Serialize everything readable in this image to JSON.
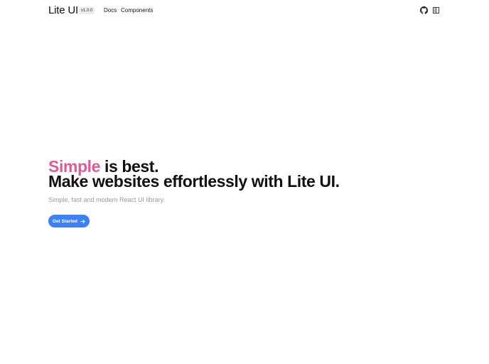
{
  "header": {
    "brand": "Lite UI",
    "version": "v1.0.0",
    "nav": [
      {
        "label": "Docs"
      },
      {
        "label": "Components"
      }
    ],
    "icons": [
      "github-icon",
      "theme-toggle-icon"
    ]
  },
  "hero": {
    "accent_word": "Simple",
    "line1_rest": " is best.",
    "line2": "Make websites effortlessly with Lite UI.",
    "subtitle": "Simple, fast and modern React UI library.",
    "cta_label": "Get Started",
    "cta_icon": "arrow-right-icon"
  },
  "colors": {
    "accent": "#e05a9a",
    "primary": "#3b82f6",
    "muted_text": "#9a9a9a"
  }
}
